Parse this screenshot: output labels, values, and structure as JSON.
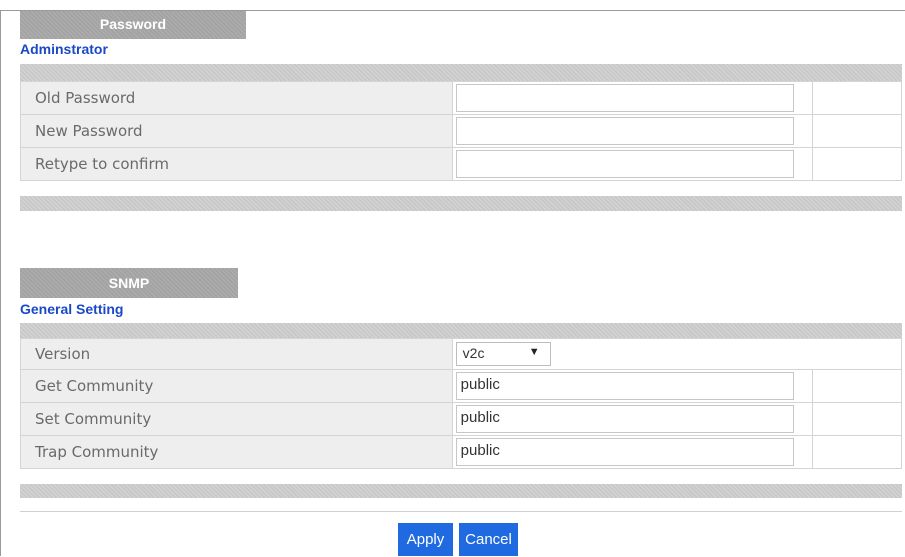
{
  "password": {
    "tab_label": "Password",
    "subhead": "Adminstrator",
    "rows": [
      {
        "label": "Old Password",
        "value": ""
      },
      {
        "label": "New Password",
        "value": ""
      },
      {
        "label": "Retype to confirm",
        "value": ""
      }
    ]
  },
  "snmp": {
    "tab_label": "SNMP",
    "subhead": "General Setting",
    "version": {
      "label": "Version",
      "selected": "v2c"
    },
    "rows": [
      {
        "label": "Get Community",
        "value": "public"
      },
      {
        "label": "Set Community",
        "value": "public"
      },
      {
        "label": "Trap Community",
        "value": "public"
      }
    ]
  },
  "buttons": {
    "apply": "Apply",
    "cancel": "Cancel"
  },
  "colors": {
    "accent": "#1f6ae0",
    "subhead": "#1a49c8",
    "tab": "#a3a3a3"
  }
}
